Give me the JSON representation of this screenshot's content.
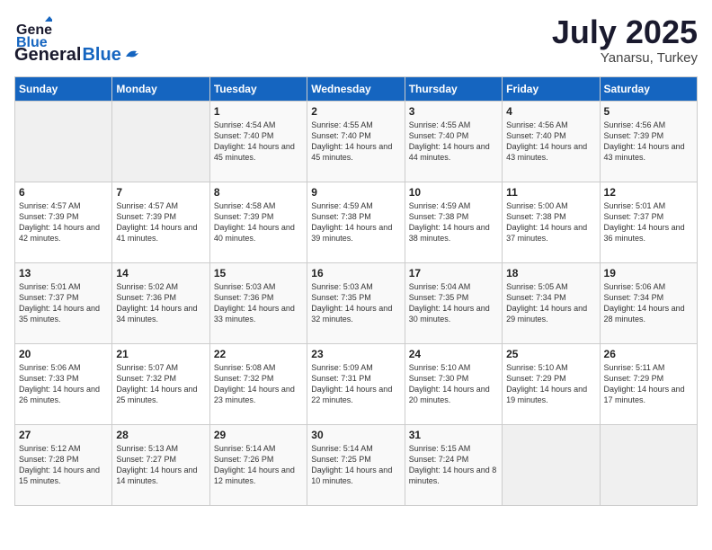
{
  "header": {
    "logo_general": "General",
    "logo_blue": "Blue",
    "month_year": "July 2025",
    "location": "Yanarsu, Turkey"
  },
  "days_of_week": [
    "Sunday",
    "Monday",
    "Tuesday",
    "Wednesday",
    "Thursday",
    "Friday",
    "Saturday"
  ],
  "weeks": [
    [
      {
        "day": "",
        "empty": true
      },
      {
        "day": "",
        "empty": true
      },
      {
        "day": "1",
        "sunrise": "4:54 AM",
        "sunset": "7:40 PM",
        "daylight": "14 hours and 45 minutes."
      },
      {
        "day": "2",
        "sunrise": "4:55 AM",
        "sunset": "7:40 PM",
        "daylight": "14 hours and 45 minutes."
      },
      {
        "day": "3",
        "sunrise": "4:55 AM",
        "sunset": "7:40 PM",
        "daylight": "14 hours and 44 minutes."
      },
      {
        "day": "4",
        "sunrise": "4:56 AM",
        "sunset": "7:40 PM",
        "daylight": "14 hours and 43 minutes."
      },
      {
        "day": "5",
        "sunrise": "4:56 AM",
        "sunset": "7:39 PM",
        "daylight": "14 hours and 43 minutes."
      }
    ],
    [
      {
        "day": "6",
        "sunrise": "4:57 AM",
        "sunset": "7:39 PM",
        "daylight": "14 hours and 42 minutes."
      },
      {
        "day": "7",
        "sunrise": "4:57 AM",
        "sunset": "7:39 PM",
        "daylight": "14 hours and 41 minutes."
      },
      {
        "day": "8",
        "sunrise": "4:58 AM",
        "sunset": "7:39 PM",
        "daylight": "14 hours and 40 minutes."
      },
      {
        "day": "9",
        "sunrise": "4:59 AM",
        "sunset": "7:38 PM",
        "daylight": "14 hours and 39 minutes."
      },
      {
        "day": "10",
        "sunrise": "4:59 AM",
        "sunset": "7:38 PM",
        "daylight": "14 hours and 38 minutes."
      },
      {
        "day": "11",
        "sunrise": "5:00 AM",
        "sunset": "7:38 PM",
        "daylight": "14 hours and 37 minutes."
      },
      {
        "day": "12",
        "sunrise": "5:01 AM",
        "sunset": "7:37 PM",
        "daylight": "14 hours and 36 minutes."
      }
    ],
    [
      {
        "day": "13",
        "sunrise": "5:01 AM",
        "sunset": "7:37 PM",
        "daylight": "14 hours and 35 minutes."
      },
      {
        "day": "14",
        "sunrise": "5:02 AM",
        "sunset": "7:36 PM",
        "daylight": "14 hours and 34 minutes."
      },
      {
        "day": "15",
        "sunrise": "5:03 AM",
        "sunset": "7:36 PM",
        "daylight": "14 hours and 33 minutes."
      },
      {
        "day": "16",
        "sunrise": "5:03 AM",
        "sunset": "7:35 PM",
        "daylight": "14 hours and 32 minutes."
      },
      {
        "day": "17",
        "sunrise": "5:04 AM",
        "sunset": "7:35 PM",
        "daylight": "14 hours and 30 minutes."
      },
      {
        "day": "18",
        "sunrise": "5:05 AM",
        "sunset": "7:34 PM",
        "daylight": "14 hours and 29 minutes."
      },
      {
        "day": "19",
        "sunrise": "5:06 AM",
        "sunset": "7:34 PM",
        "daylight": "14 hours and 28 minutes."
      }
    ],
    [
      {
        "day": "20",
        "sunrise": "5:06 AM",
        "sunset": "7:33 PM",
        "daylight": "14 hours and 26 minutes."
      },
      {
        "day": "21",
        "sunrise": "5:07 AM",
        "sunset": "7:32 PM",
        "daylight": "14 hours and 25 minutes."
      },
      {
        "day": "22",
        "sunrise": "5:08 AM",
        "sunset": "7:32 PM",
        "daylight": "14 hours and 23 minutes."
      },
      {
        "day": "23",
        "sunrise": "5:09 AM",
        "sunset": "7:31 PM",
        "daylight": "14 hours and 22 minutes."
      },
      {
        "day": "24",
        "sunrise": "5:10 AM",
        "sunset": "7:30 PM",
        "daylight": "14 hours and 20 minutes."
      },
      {
        "day": "25",
        "sunrise": "5:10 AM",
        "sunset": "7:29 PM",
        "daylight": "14 hours and 19 minutes."
      },
      {
        "day": "26",
        "sunrise": "5:11 AM",
        "sunset": "7:29 PM",
        "daylight": "14 hours and 17 minutes."
      }
    ],
    [
      {
        "day": "27",
        "sunrise": "5:12 AM",
        "sunset": "7:28 PM",
        "daylight": "14 hours and 15 minutes."
      },
      {
        "day": "28",
        "sunrise": "5:13 AM",
        "sunset": "7:27 PM",
        "daylight": "14 hours and 14 minutes."
      },
      {
        "day": "29",
        "sunrise": "5:14 AM",
        "sunset": "7:26 PM",
        "daylight": "14 hours and 12 minutes."
      },
      {
        "day": "30",
        "sunrise": "5:14 AM",
        "sunset": "7:25 PM",
        "daylight": "14 hours and 10 minutes."
      },
      {
        "day": "31",
        "sunrise": "5:15 AM",
        "sunset": "7:24 PM",
        "daylight": "14 hours and 8 minutes."
      },
      {
        "day": "",
        "empty": true
      },
      {
        "day": "",
        "empty": true
      }
    ]
  ]
}
